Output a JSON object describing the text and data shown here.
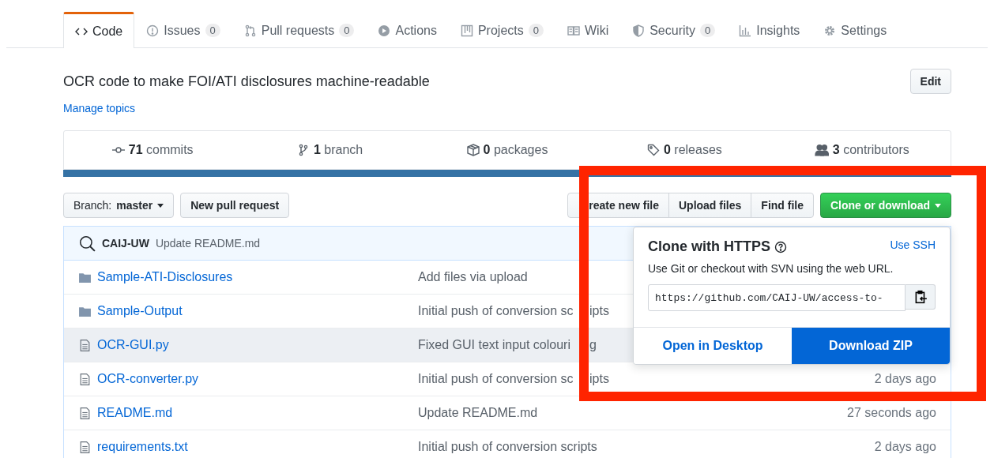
{
  "tabs": [
    {
      "label": "Code",
      "selected": true
    },
    {
      "label": "Issues",
      "count": "0",
      "selected": false
    },
    {
      "label": "Pull requests",
      "count": "0",
      "selected": false
    },
    {
      "label": "Actions",
      "selected": false
    },
    {
      "label": "Projects",
      "count": "0",
      "selected": false
    },
    {
      "label": "Wiki",
      "selected": false
    },
    {
      "label": "Security",
      "count": "0",
      "selected": false
    },
    {
      "label": "Insights",
      "selected": false
    },
    {
      "label": "Settings",
      "selected": false
    }
  ],
  "repo": {
    "description": "OCR code to make FOI/ATI disclosures machine-readable",
    "edit_button": "Edit",
    "topics_link": "Manage topics"
  },
  "stats": [
    "**71** commits",
    "**1** branch",
    "**0** packages",
    "**0** releases",
    "**3** contributors"
  ],
  "toolbar": {
    "branch": "Branch: **master**",
    "new_pull_request": "New pull request",
    "file_buttons": [
      "reate new file",
      "Upload files",
      "Find file"
    ],
    "clone_button": "Clone or download"
  },
  "latest_commit": {
    "author": "CAIJ-UW",
    "message": "Update README.md"
  },
  "files": [
    {
      "kind": "folder",
      "name": "Sample-ATI-Disclosures",
      "message": "Add files via upload",
      "hovered": false
    },
    {
      "kind": "folder",
      "name": "Sample-Output",
      "message": "Initial push of conversion sc",
      "message_after_frame": "ipts",
      "hovered": false
    },
    {
      "kind": "file",
      "name": "OCR-GUI.py",
      "message": "Fixed GUI text input colouri",
      "message_after_frame": "g",
      "hovered": true
    },
    {
      "kind": "file",
      "name": "OCR-converter.py",
      "message": "Initial push of conversion sc",
      "message_after_frame": "ipts",
      "age": "2 days ago",
      "hovered": false
    },
    {
      "kind": "file",
      "name": "README.md",
      "message": "Update README.md",
      "age": "27 seconds ago",
      "hovered": false
    },
    {
      "kind": "file",
      "name": "requirements.txt",
      "message": "Initial push of conversion scripts",
      "age": "2 days ago",
      "hovered": false
    }
  ],
  "clone_popover": {
    "title": "Clone with HTTPS",
    "switch_link": "Use SSH",
    "hint": "Use Git or checkout with SVN using the web URL.",
    "url": "https://github.com/CAIJ-UW/access-to-",
    "open_desktop": "Open in Desktop",
    "download_zip": "Download ZIP"
  }
}
